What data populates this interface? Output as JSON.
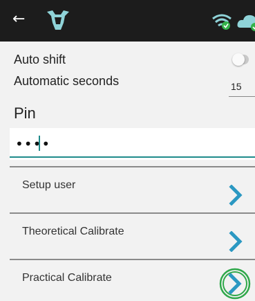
{
  "toolbar": {
    "back_icon": "back-arrow-icon",
    "logo_icon": "cow-head-logo-icon",
    "wifi_icon": "wifi-connected-icon",
    "cloud_icon": "cloud-connected-icon"
  },
  "settings": {
    "auto_shift_label": "Auto shift",
    "auto_shift_on": false,
    "automatic_seconds_label": "Automatic seconds",
    "automatic_seconds_value": "15"
  },
  "pin": {
    "label": "Pin",
    "value": "••••"
  },
  "menu": {
    "items": [
      {
        "label": "Setup user",
        "icon": "chevron-right-icon"
      },
      {
        "label": "Theoretical Calibrate",
        "icon": "chevron-right-icon"
      },
      {
        "label": "Practical Calibrate",
        "icon": "chevron-right-icon",
        "highlighted": true
      }
    ]
  },
  "colors": {
    "topbar": "#1c1c1c",
    "accent": "#1e8a8a",
    "chevron": "#2b98c2",
    "highlight_ring": "#2fa84a",
    "status_ok": "#35b24a"
  }
}
